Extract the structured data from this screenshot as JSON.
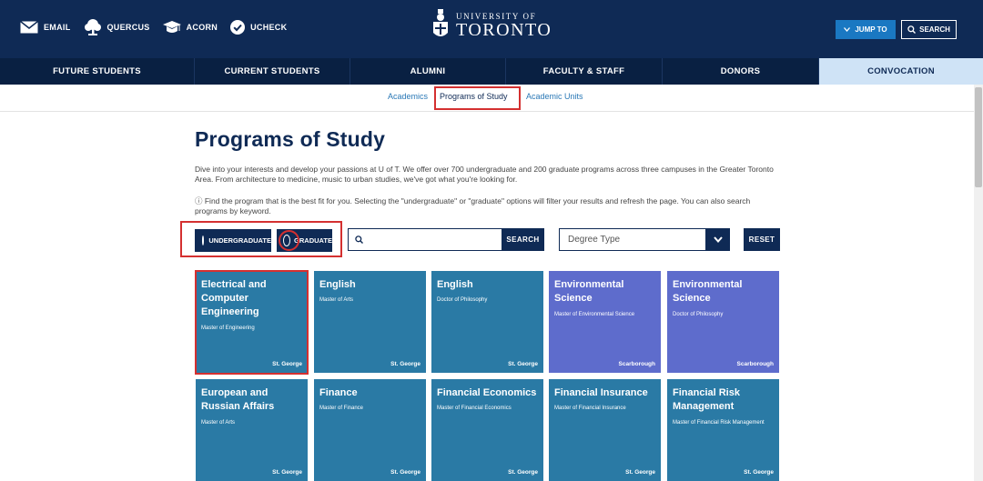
{
  "colors": {
    "navy": "#0f2a55",
    "teal_card": "#2a7aa5",
    "purple_card": "#5e6ccc",
    "highlight_red": "#d43030",
    "link_blue": "#2a78b6"
  },
  "header": {
    "quicklinks": [
      {
        "label": "EMAIL",
        "icon": "envelope-icon"
      },
      {
        "label": "QUERCUS",
        "icon": "tree-icon"
      },
      {
        "label": "ACORN",
        "icon": "graduation-cap-icon"
      },
      {
        "label": "UCHECK",
        "icon": "check-circle-icon"
      }
    ],
    "logo_univ": "UNIVERSITY OF",
    "logo_toronto": "TORONTO",
    "jump_label": "JUMP TO",
    "search_label": "SEARCH"
  },
  "nav": {
    "items": [
      "FUTURE STUDENTS",
      "CURRENT STUDENTS",
      "ALUMNI",
      "FACULTY & STAFF",
      "DONORS",
      "CONVOCATION"
    ],
    "active": "CONVOCATION"
  },
  "subnav": {
    "items": [
      "Academics",
      "Programs of Study",
      "Academic Units"
    ],
    "selected": "Programs of Study"
  },
  "page": {
    "title": "Programs of Study",
    "intro": "Dive into your interests and develop your passions at U of T. We offer over 700 undergraduate and 200 graduate programs across three campuses in the Greater Toronto Area. From architecture to medicine, music to urban studies, we've got what you're looking for.",
    "info": "ⓘ Find the program that is the best fit for you. Selecting the \"undergraduate\" or \"graduate\" options will filter your results and refresh the page. You can also search programs by keyword."
  },
  "filters": {
    "undergraduate_label": "UNDERGRADUATE",
    "graduate_label": "GRADUATE",
    "selected_level": "graduate",
    "search_value": "",
    "search_button": "SEARCH",
    "degree_placeholder": "Degree Type",
    "reset_label": "RESET"
  },
  "programs": [
    {
      "title": "Electrical and Computer Engineering",
      "degree": "Master of Engineering",
      "campus": "St. George",
      "color": "#2a7aa5"
    },
    {
      "title": "English",
      "degree": "Master of Arts",
      "campus": "St. George",
      "color": "#2a7aa5"
    },
    {
      "title": "English",
      "degree": "Doctor of Philosophy",
      "campus": "St. George",
      "color": "#2a7aa5"
    },
    {
      "title": "Environmental Science",
      "degree": "Master of Environmental Science",
      "campus": "Scarborough",
      "color": "#5e6ccc"
    },
    {
      "title": "Environmental Science",
      "degree": "Doctor of Philosophy",
      "campus": "Scarborough",
      "color": "#5e6ccc"
    },
    {
      "title": "European and Russian Affairs",
      "degree": "Master of Arts",
      "campus": "St. George",
      "color": "#2a7aa5"
    },
    {
      "title": "Finance",
      "degree": "Master of Finance",
      "campus": "St. George",
      "color": "#2a7aa5"
    },
    {
      "title": "Financial Economics",
      "degree": "Master of Financial Economics",
      "campus": "St. George",
      "color": "#2a7aa5"
    },
    {
      "title": "Financial Insurance",
      "degree": "Master of Financial Insurance",
      "campus": "St. George",
      "color": "#2a7aa5"
    },
    {
      "title": "Financial Risk Management",
      "degree": "Master of Financial Risk Management",
      "campus": "St. George",
      "color": "#2a7aa5"
    }
  ]
}
